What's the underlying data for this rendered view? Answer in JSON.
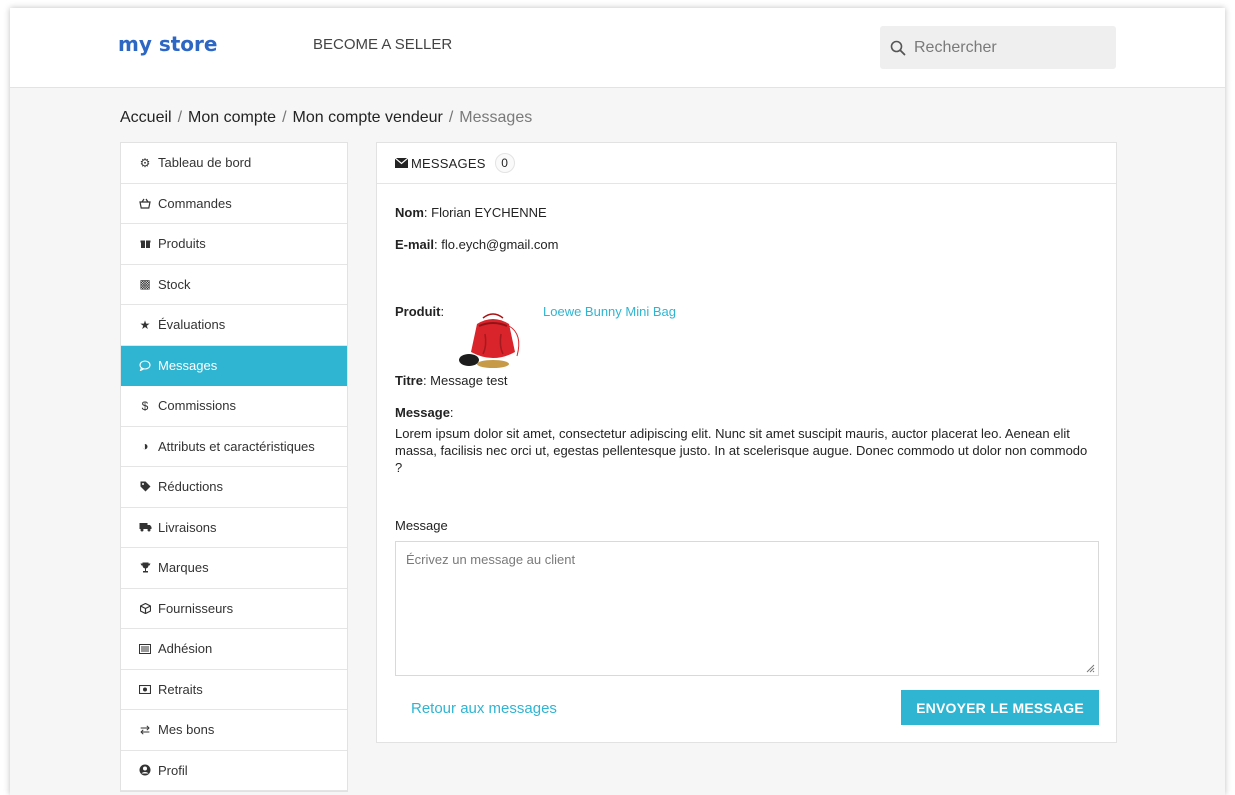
{
  "header": {
    "logo_text": "my store",
    "become_seller": "BECOME A SELLER",
    "search_placeholder": "Rechercher"
  },
  "breadcrumb": {
    "items": [
      "Accueil",
      "Mon compte",
      "Mon compte vendeur"
    ],
    "current": "Messages",
    "separator": "/"
  },
  "sidebar": {
    "items": [
      {
        "label": "Tableau de bord",
        "icon": "dashboard-icon"
      },
      {
        "label": "Commandes",
        "icon": "basket-icon"
      },
      {
        "label": "Produits",
        "icon": "gift-icon"
      },
      {
        "label": "Stock",
        "icon": "cubes-icon"
      },
      {
        "label": "Évaluations",
        "icon": "star-icon"
      },
      {
        "label": "Messages",
        "icon": "chat-bubble-icon",
        "active": true
      },
      {
        "label": "Commissions",
        "icon": "dollar-icon"
      },
      {
        "label": "Attributs et caractéristiques",
        "icon": "adjust-icon"
      },
      {
        "label": "Réductions",
        "icon": "tag-icon"
      },
      {
        "label": "Livraisons",
        "icon": "truck-icon"
      },
      {
        "label": "Marques",
        "icon": "trophy-icon"
      },
      {
        "label": "Fournisseurs",
        "icon": "box-icon"
      },
      {
        "label": "Adhésion",
        "icon": "list-icon"
      },
      {
        "label": "Retraits",
        "icon": "money-icon"
      },
      {
        "label": "Mes bons",
        "icon": "exchange-icon"
      },
      {
        "label": "Profil",
        "icon": "user-circle-icon"
      }
    ]
  },
  "panel": {
    "title": "MESSAGES",
    "count": "0",
    "name_label": "Nom",
    "name_value": "Florian EYCHENNE",
    "email_label": "E-mail",
    "email_value": "flo.eych@gmail.com",
    "product_label": "Produit",
    "product_name": "Loewe Bunny Mini Bag",
    "title_label": "Titre",
    "title_value": "Message test",
    "message_label": "Message",
    "message_text": "Lorem ipsum dolor sit amet, consectetur adipiscing elit. Nunc sit amet suscipit mauris, auctor placerat leo. Aenean elit massa, facilisis nec orci ut, egestas pellentesque justo. In at scelerisque augue. Donec commodo ut dolor non commodo ?",
    "reply_label": "Message",
    "reply_placeholder": "Écrivez un message au client",
    "back_link": "Retour aux messages",
    "send_button": "ENVOYER LE MESSAGE"
  },
  "colors": {
    "accent": "#2fb5d2",
    "background": "#f6f6f6"
  }
}
